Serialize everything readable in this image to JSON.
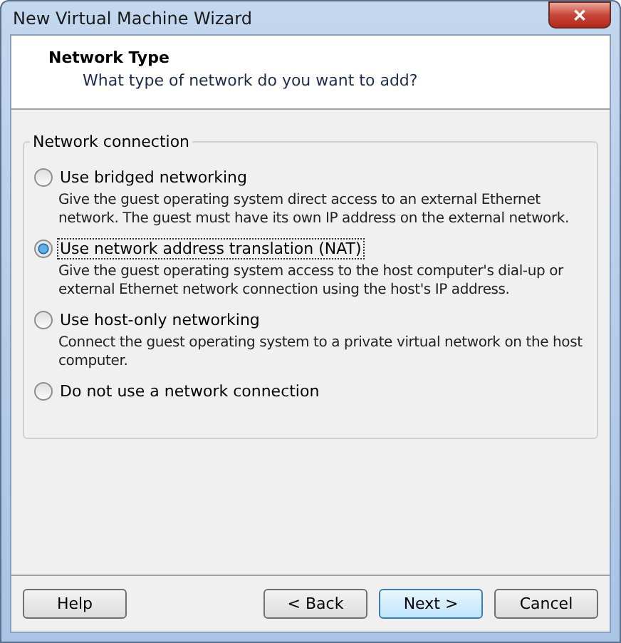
{
  "window": {
    "title": "New Virtual Machine Wizard",
    "close": "✕"
  },
  "header": {
    "title": "Network Type",
    "subtitle": "What type of network do you want to add?"
  },
  "group": {
    "title": "Network connection",
    "options": [
      {
        "label": "Use bridged networking",
        "description": "Give the guest operating system direct access to an external Ethernet network. The guest must have its own IP address on the external network.",
        "selected": false
      },
      {
        "label": "Use network address translation (NAT)",
        "description": "Give the guest operating system access to the host computer's dial-up or external Ethernet network connection using the host's IP address.",
        "selected": true
      },
      {
        "label": "Use host-only networking",
        "description": "Connect the guest operating system to a private virtual network on the host computer.",
        "selected": false
      },
      {
        "label": "Do not use a network connection",
        "selected": false
      }
    ]
  },
  "buttons": [
    {
      "label": "Help",
      "kind": "help",
      "default": false
    },
    {
      "label": "< Back",
      "kind": "nav",
      "default": false
    },
    {
      "label": "Next >",
      "kind": "nav",
      "default": true
    },
    {
      "label": "Cancel",
      "kind": "nav",
      "default": false
    }
  ]
}
